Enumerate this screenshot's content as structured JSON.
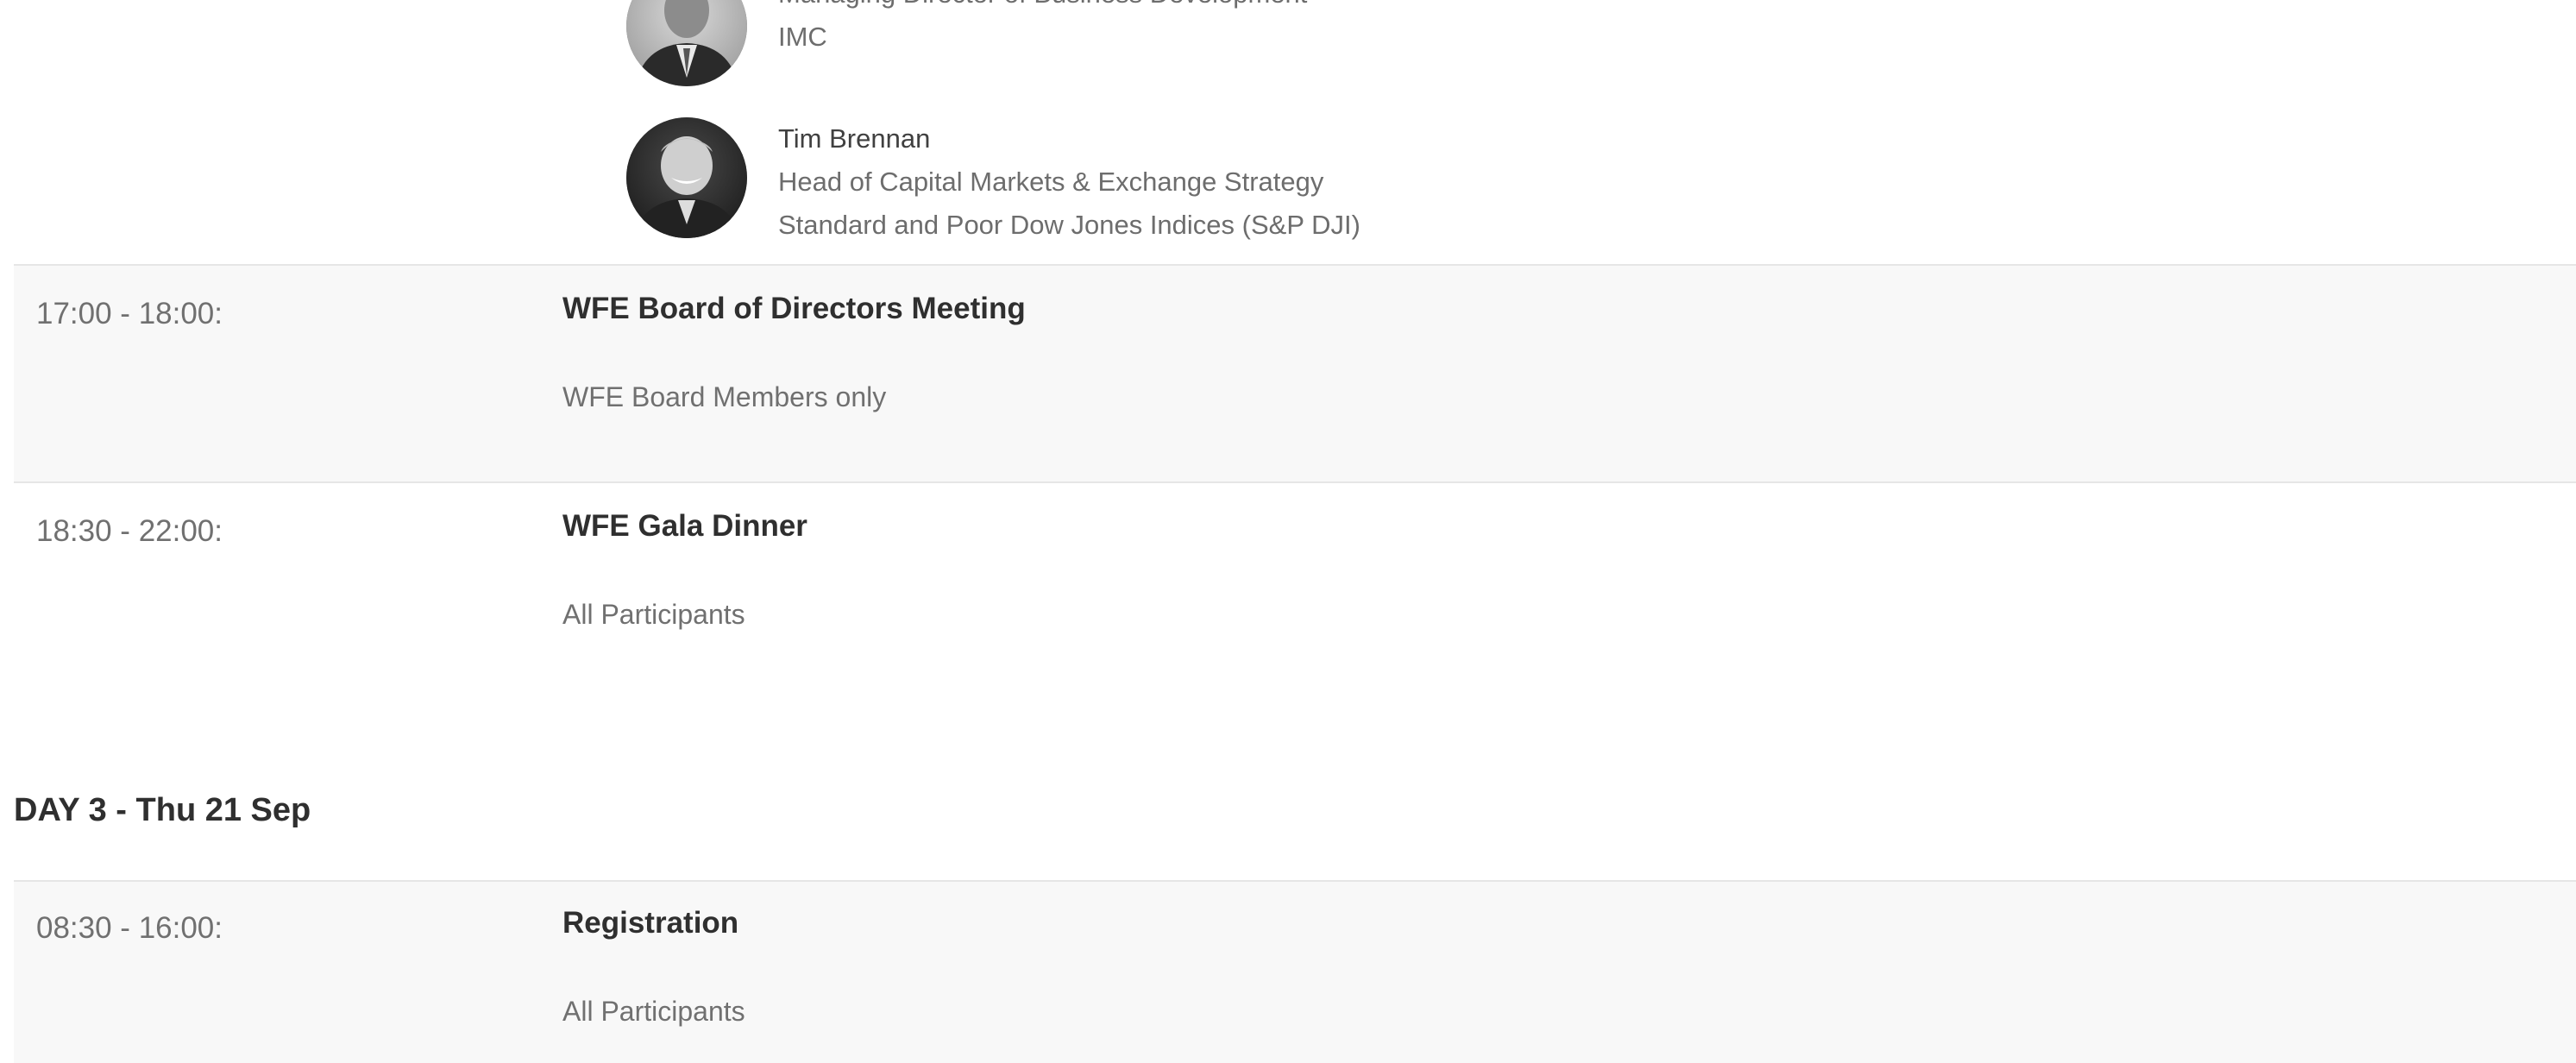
{
  "speakers": [
    {
      "name": "",
      "role": "Managing Director of Business Development",
      "org": "IMC"
    },
    {
      "name": "Tim Brennan",
      "role": "Head of Capital Markets & Exchange Strategy",
      "org": "Standard and Poor Dow Jones Indices (S&P DJI)"
    }
  ],
  "sessions": [
    {
      "time": "17:00 - 18:00:",
      "title": "WFE Board of Directors Meeting",
      "audience": "WFE Board Members only"
    },
    {
      "time": "18:30 - 22:00:",
      "title": "WFE Gala Dinner",
      "audience": "All Participants"
    }
  ],
  "day3": {
    "heading": "DAY 3 - Thu 21 Sep",
    "sessions": [
      {
        "time": "08:30 - 16:00:",
        "title": "Registration",
        "audience": "All Participants"
      }
    ]
  }
}
